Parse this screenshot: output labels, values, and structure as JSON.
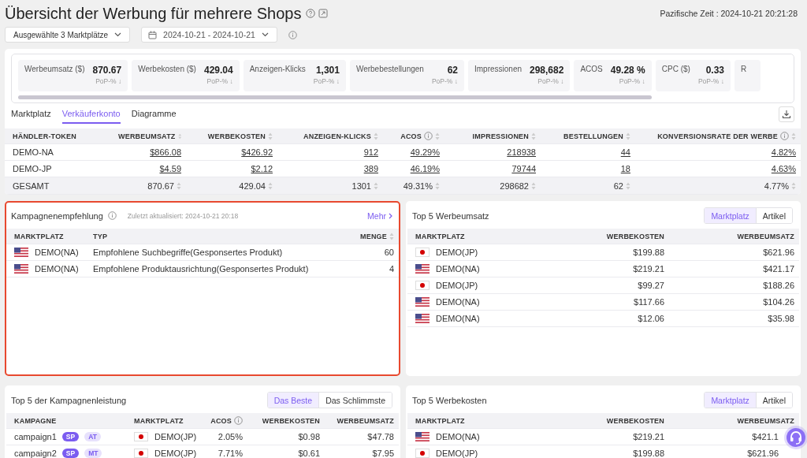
{
  "header": {
    "title": "Übersicht der Werbung für mehrere Shops",
    "time_label": "Pazifische Zeit :",
    "time": "2024-10-21 20:21:28"
  },
  "filters": {
    "marketplace_select": "Ausgewählte 3 Marktplätze",
    "date_range": "2024-10-21 - 2024-10-21"
  },
  "metrics": [
    {
      "label": "Werbeumsatz ($)",
      "value": "870.67",
      "change": "PoP-% ↓"
    },
    {
      "label": "Werbekosten ($)",
      "value": "429.04",
      "change": "PoP-% ↓"
    },
    {
      "label": "Anzeigen-Klicks",
      "value": "1,301",
      "change": "PoP-% ↓"
    },
    {
      "label": "Werbebestellungen",
      "value": "62",
      "change": "PoP-% ↓"
    },
    {
      "label": "Impressionen",
      "value": "298,682",
      "change": "PoP-% ↓"
    },
    {
      "label": "ACOS",
      "value": "49.28 %",
      "change": "PoP-% ↓"
    },
    {
      "label": "CPC ($)",
      "value": "0.33",
      "change": "PoP-% ↓"
    },
    {
      "label": "R"
    }
  ],
  "tabs": [
    {
      "label": "Marktplatz",
      "selected": false
    },
    {
      "label": "Verkäuferkonto",
      "selected": true
    },
    {
      "label": "Diagramme",
      "selected": false
    }
  ],
  "account_table": {
    "columns": [
      {
        "label": "HÄNDLER-TOKEN",
        "sortable": false,
        "info": false
      },
      {
        "label": "WERBEUMSATZ",
        "sortable": true,
        "info": false
      },
      {
        "label": "WERBEKOSTEN",
        "sortable": true,
        "info": false
      },
      {
        "label": "ANZEIGEN-KLICKS",
        "sortable": true,
        "info": false
      },
      {
        "label": "ACOS",
        "sortable": true,
        "info": true
      },
      {
        "label": "IMPRESSIONEN",
        "sortable": true,
        "info": false
      },
      {
        "label": "BESTELLUNGEN",
        "sortable": true,
        "info": false
      },
      {
        "label": "KONVERSIONSRATE DER WERBE",
        "sortable": true,
        "info": true
      }
    ],
    "rows": [
      {
        "kind": "data",
        "cells": [
          "DEMO-NA",
          "$866.08",
          "$426.92",
          "912",
          "49.29%",
          "218938",
          "44",
          "4.82%"
        ]
      },
      {
        "kind": "data",
        "cells": [
          "DEMO-JP",
          "$4.59",
          "$2.12",
          "389",
          "46.19%",
          "79744",
          "18",
          "4.63%"
        ]
      },
      {
        "kind": "total",
        "cells": [
          "GESAMT",
          "870.67",
          "429.04",
          "1301",
          "49.31%",
          "298682",
          "62",
          "4.77%"
        ]
      }
    ]
  },
  "recommendation_panel": {
    "title": "Kampagnenempfehlung",
    "info": true,
    "updated": "Zuletzt aktualisiert: 2024-10-21 20:18",
    "more": "Mehr",
    "highlighted": true,
    "columns": [
      {
        "label": "MARKTPLATZ",
        "sortable": false,
        "info": false
      },
      {
        "label": "TYP",
        "sortable": false,
        "info": false
      },
      {
        "label": "MENGE",
        "sortable": true,
        "info": false
      }
    ],
    "rows": [
      {
        "cells": [
          {
            "text": "DEMO(NA)",
            "kind": "us"
          },
          "Empfohlene Suchbegriffe(Gesponsertes Produkt)",
          "60"
        ]
      },
      {
        "cells": [
          {
            "text": "DEMO(NA)",
            "kind": "us"
          },
          "Empfohlene Produktausrichtung(Gesponsertes Produkt)",
          "4"
        ]
      }
    ]
  },
  "top_revenue_panel": {
    "title": "Top 5 Werbeumsatz",
    "highlighted": false,
    "toggle": [
      {
        "label": "Marktplatz",
        "selected": true
      },
      {
        "label": "Artikel",
        "selected": false
      }
    ],
    "columns": [
      {
        "label": "MARKTPLATZ",
        "sortable": false,
        "info": false
      },
      {
        "label": "WERBEKOSTEN",
        "sortable": false,
        "info": false
      },
      {
        "label": "WERBEUMSATZ",
        "sortable": false,
        "info": false
      }
    ],
    "rows": [
      {
        "cells": [
          {
            "text": "DEMO(JP)",
            "kind": "jp"
          },
          "$199.88",
          "$621.96"
        ]
      },
      {
        "cells": [
          {
            "text": "DEMO(NA)",
            "kind": "us"
          },
          "$219.21",
          "$421.17"
        ]
      },
      {
        "cells": [
          {
            "text": "DEMO(JP)",
            "kind": "jp"
          },
          "$99.27",
          "$188.26"
        ]
      },
      {
        "cells": [
          {
            "text": "DEMO(NA)",
            "kind": "us"
          },
          "$117.66",
          "$104.26"
        ]
      },
      {
        "cells": [
          {
            "text": "DEMO(NA)",
            "kind": "us"
          },
          "$12.06",
          "$35.98"
        ]
      }
    ]
  },
  "campaign_panel": {
    "title": "Top 5 der Kampagnenleistung",
    "highlighted": false,
    "toggle": [
      {
        "label": "Das Beste",
        "selected": true
      },
      {
        "label": "Das Schlimmste",
        "selected": false
      }
    ],
    "columns": [
      {
        "label": "KAMPAGNE",
        "sortable": false,
        "info": false
      },
      {
        "label": "MARKTPLATZ",
        "sortable": false,
        "info": false
      },
      {
        "label": "ACOS",
        "sortable": false,
        "info": true
      },
      {
        "label": "WERBEKOSTEN",
        "sortable": false,
        "info": false
      },
      {
        "label": "WERBEUMSATZ",
        "sortable": false,
        "info": false
      }
    ],
    "rows": [
      {
        "cells": [
          {
            "text": "campaign1",
            "tags": [
              {
                "label": "SP",
                "kind": "solid"
              },
              {
                "label": "AT",
                "kind": "light"
              }
            ]
          },
          {
            "text": "DEMO(JP)",
            "kind": "jp"
          },
          "2.05%",
          "$0.98",
          "$47.78"
        ]
      },
      {
        "cells": [
          {
            "text": "campaign2",
            "tags": [
              {
                "label": "SP",
                "kind": "solid"
              },
              {
                "label": "MT",
                "kind": "light"
              }
            ]
          },
          {
            "text": "DEMO(JP)",
            "kind": "jp"
          },
          "7.71%",
          "$0.61",
          "$7.95"
        ]
      }
    ]
  },
  "top_cost_panel": {
    "title": "Top 5 Werbekosten",
    "highlighted": false,
    "toggle": [
      {
        "label": "Marktplatz",
        "selected": true
      },
      {
        "label": "Artikel",
        "selected": false
      }
    ],
    "columns": [
      {
        "label": "MARKTPLATZ",
        "sortable": false,
        "info": false
      },
      {
        "label": "WERBEKOSTEN",
        "sortable": false,
        "info": false
      },
      {
        "label": "WERBEUMSATZ",
        "sortable": false,
        "info": false
      }
    ],
    "rows": [
      {
        "cells": [
          {
            "text": "DEMO(NA)",
            "kind": "us"
          },
          "$219.21",
          "$421.1"
        ]
      },
      {
        "cells": [
          {
            "text": "DEMO(JP)",
            "kind": "jp"
          },
          "$199.88",
          "$621.96"
        ]
      }
    ]
  }
}
